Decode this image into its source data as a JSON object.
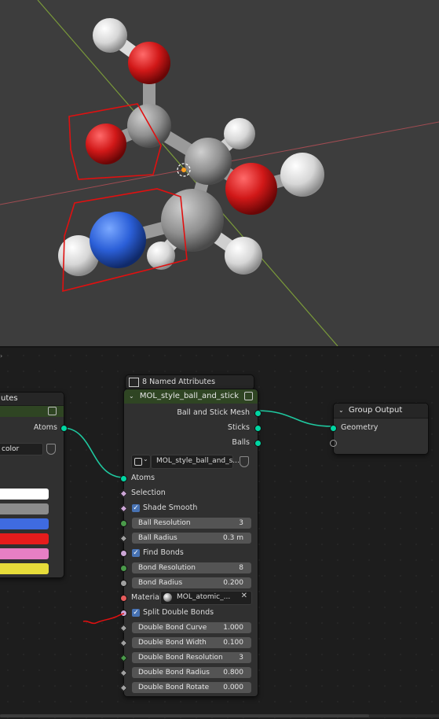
{
  "viewport": {
    "description_icons": [
      "origin-icon"
    ]
  },
  "left_node": {
    "title_partial": "utes",
    "output_label": "Atoms",
    "color_field": "color",
    "swatches": [
      "#ffffff",
      "#8c8c8c",
      "#3f6be0",
      "#e61c1c",
      "#e67fc4",
      "#e6dc3a"
    ]
  },
  "named_attr_node": {
    "title": "8 Named Attributes"
  },
  "main_node": {
    "title": "MOL_style_ball_and_stick",
    "outputs": [
      "Ball and Stick Mesh",
      "Sticks",
      "Balls"
    ],
    "datablock": "MOL_style_ball_and_s...",
    "atoms_label": "Atoms",
    "selection_label": "Selection",
    "shade_smooth_label": "Shade Smooth",
    "ball_resolution": {
      "label": "Ball Resolution",
      "value": "3"
    },
    "ball_radius": {
      "label": "Ball Radius",
      "value": "0.3 m"
    },
    "find_bonds_label": "Find Bonds",
    "bond_resolution": {
      "label": "Bond Resolution",
      "value": "8"
    },
    "bond_radius": {
      "label": "Bond Radius",
      "value": "0.200"
    },
    "material_label": "Material:",
    "material_value": "MOL_atomic_...",
    "split_double_bonds_label": "Split Double Bonds",
    "double_bond_curve": {
      "label": "Double Bond Curve",
      "value": "1.000"
    },
    "double_bond_width": {
      "label": "Double Bond Width",
      "value": "0.100"
    },
    "double_bond_resolution": {
      "label": "Double Bond Resolution",
      "value": "3"
    },
    "double_bond_radius": {
      "label": "Double Bond Radius",
      "value": "0.800"
    },
    "double_bond_rotate": {
      "label": "Double Bond Rotate",
      "value": "0.000"
    }
  },
  "group_output": {
    "title": "Group Output",
    "input_label": "Geometry"
  },
  "colors": {
    "teal_link": "#1fc9a0",
    "node_header_green": "#2f4523",
    "annotation_red": "#e01010"
  }
}
